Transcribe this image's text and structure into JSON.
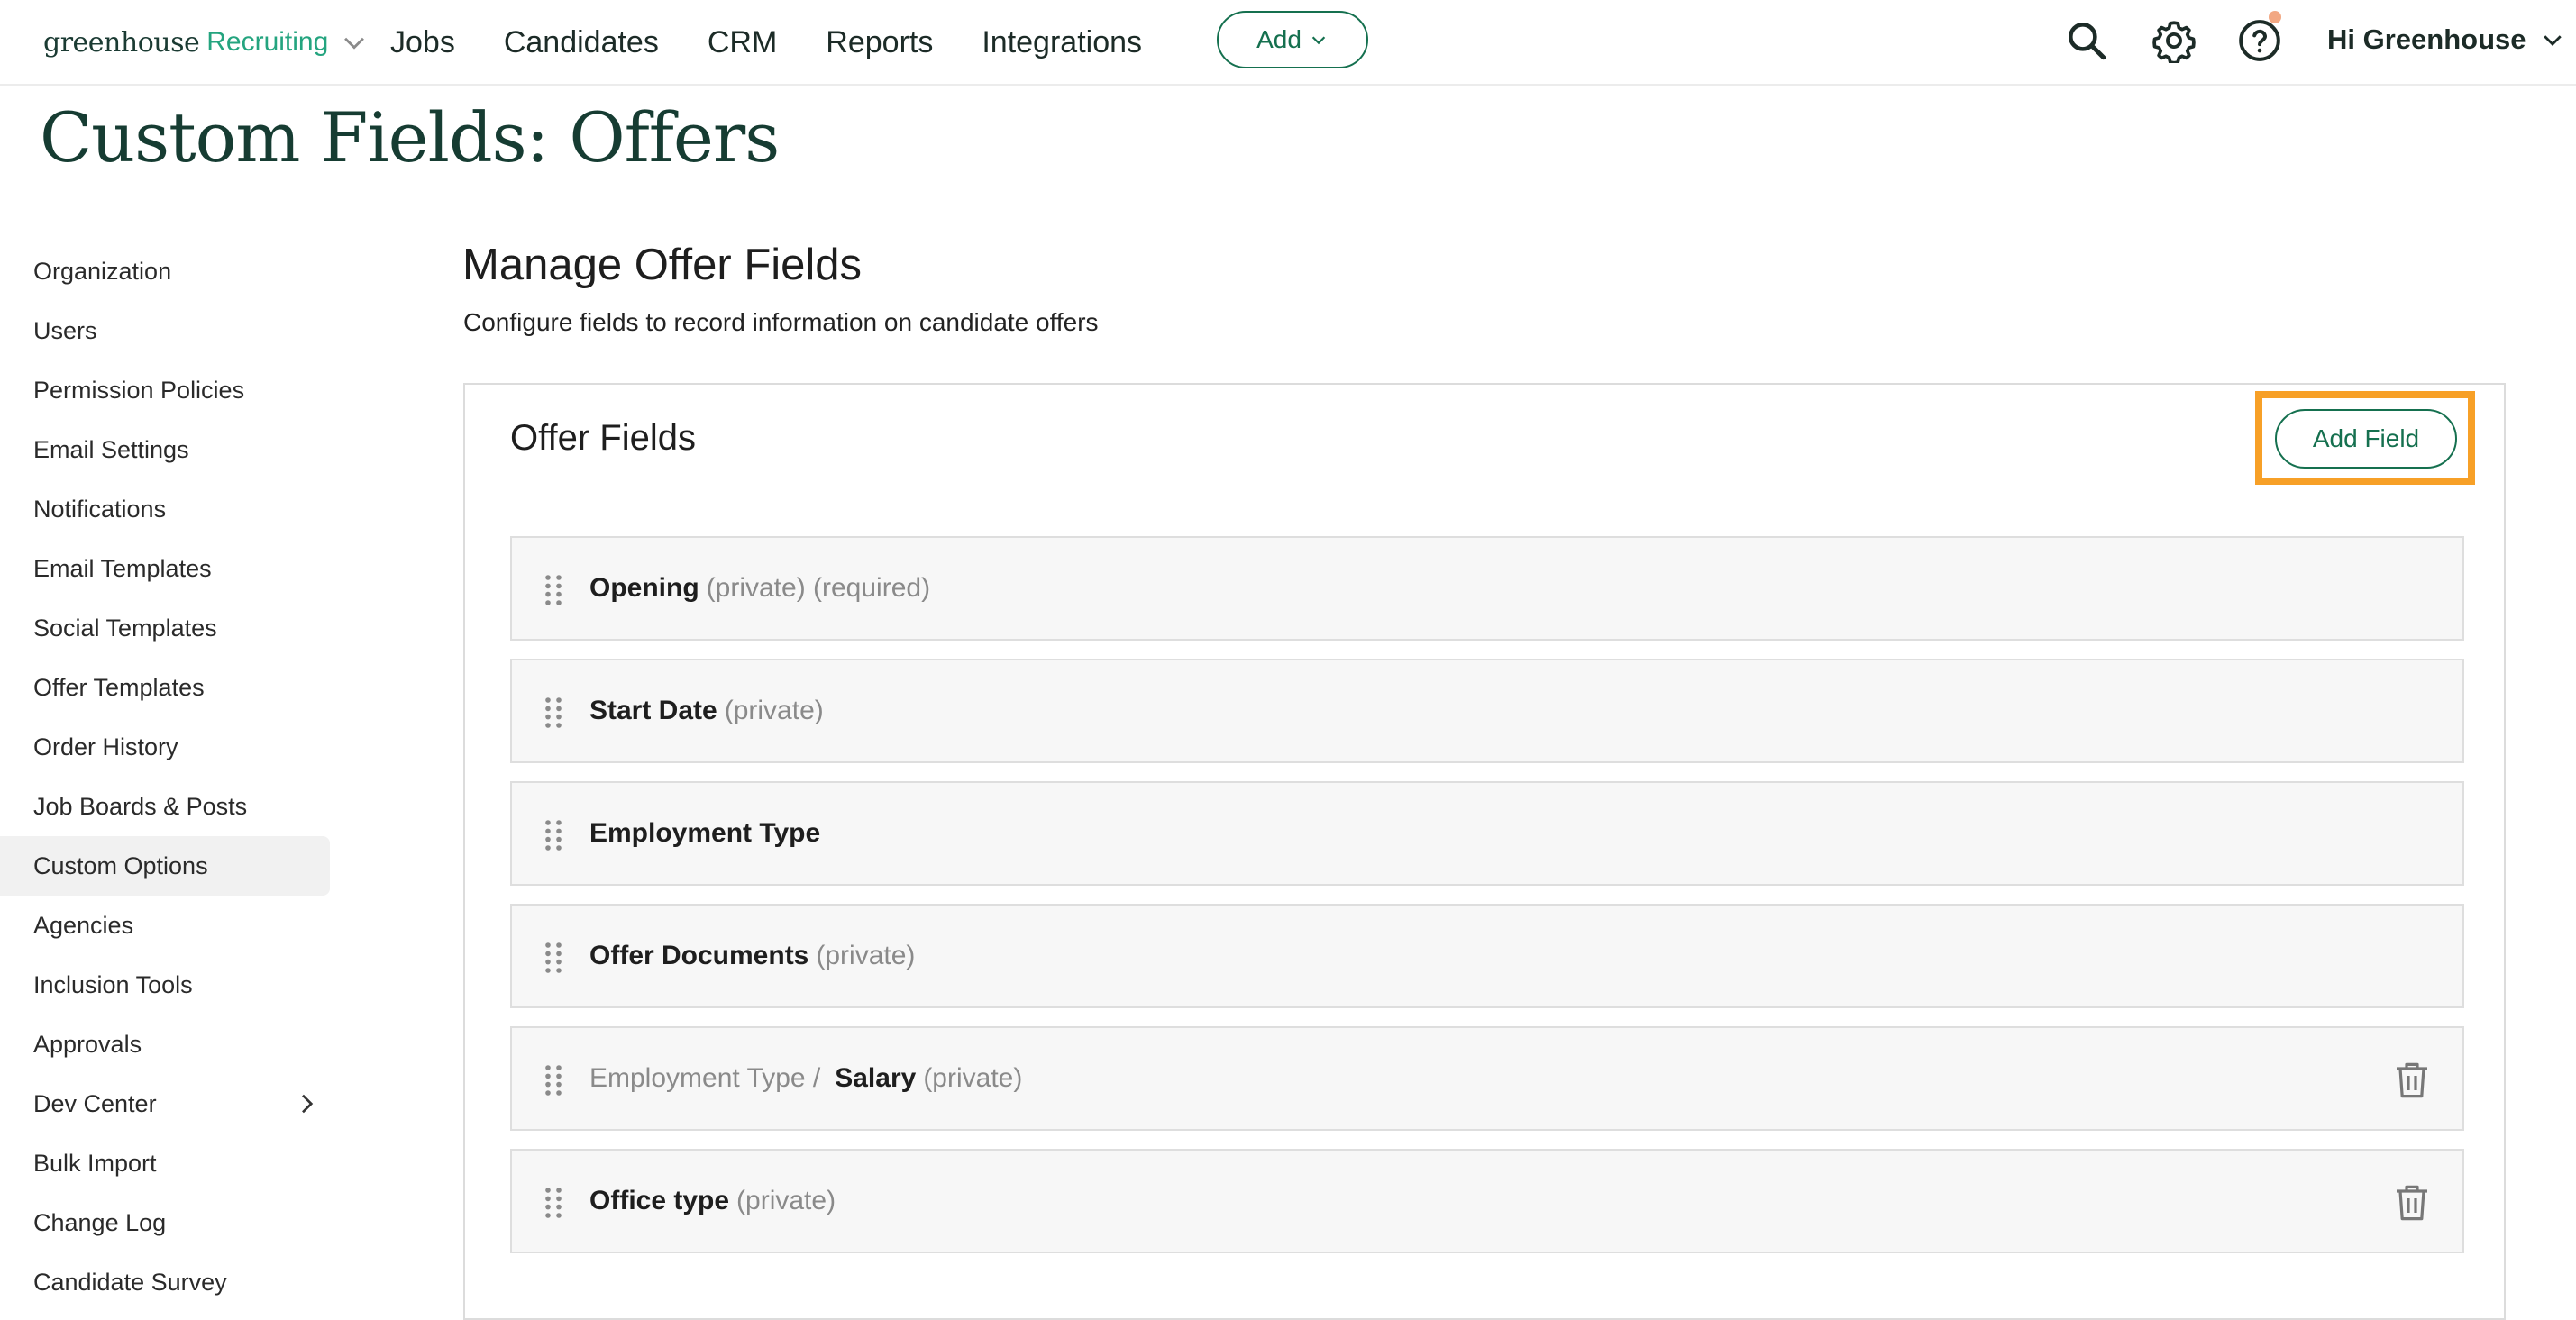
{
  "nav": {
    "brand": "greenhouse",
    "product": "Recruiting",
    "links": [
      "Jobs",
      "Candidates",
      "CRM",
      "Reports",
      "Integrations"
    ],
    "add_label": "Add",
    "user_greeting": "Hi Greenhouse",
    "icons": [
      "search-icon",
      "gear-icon",
      "help-icon",
      "chevron-down-icon"
    ],
    "notification_dot_color": "#f2a883"
  },
  "page": {
    "title": "Custom Fields: Offers"
  },
  "sidebar": {
    "items": [
      {
        "label": "Organization"
      },
      {
        "label": "Users"
      },
      {
        "label": "Permission Policies"
      },
      {
        "label": "Email Settings"
      },
      {
        "label": "Notifications"
      },
      {
        "label": "Email Templates"
      },
      {
        "label": "Social Templates"
      },
      {
        "label": "Offer Templates"
      },
      {
        "label": "Order History"
      },
      {
        "label": "Job Boards & Posts"
      },
      {
        "label": "Custom Options",
        "active": true
      },
      {
        "label": "Agencies"
      },
      {
        "label": "Inclusion Tools"
      },
      {
        "label": "Approvals"
      },
      {
        "label": "Dev Center",
        "has_submenu": true
      },
      {
        "label": "Bulk Import"
      },
      {
        "label": "Change Log"
      },
      {
        "label": "Candidate Survey"
      }
    ]
  },
  "main": {
    "title": "Manage Offer Fields",
    "description": "Configure fields to record information on candidate offers",
    "panel": {
      "title": "Offer Fields",
      "add_button": "Add Field",
      "highlight_color": "#f7a027",
      "fields": [
        {
          "parent": "",
          "name": "Opening",
          "tags": "(private) (required)",
          "deletable": false
        },
        {
          "parent": "",
          "name": "Start Date",
          "tags": "(private)",
          "deletable": false
        },
        {
          "parent": "",
          "name": "Employment Type",
          "tags": "",
          "deletable": false
        },
        {
          "parent": "",
          "name": "Offer Documents",
          "tags": "(private)",
          "deletable": false
        },
        {
          "parent": "Employment Type /",
          "name": "Salary",
          "tags": "(private)",
          "deletable": true
        },
        {
          "parent": "",
          "name": "Office type",
          "tags": "(private)",
          "deletable": true
        }
      ]
    }
  },
  "colors": {
    "accent": "#15704f",
    "brand_green": "#24a47f",
    "title": "#163c32"
  }
}
